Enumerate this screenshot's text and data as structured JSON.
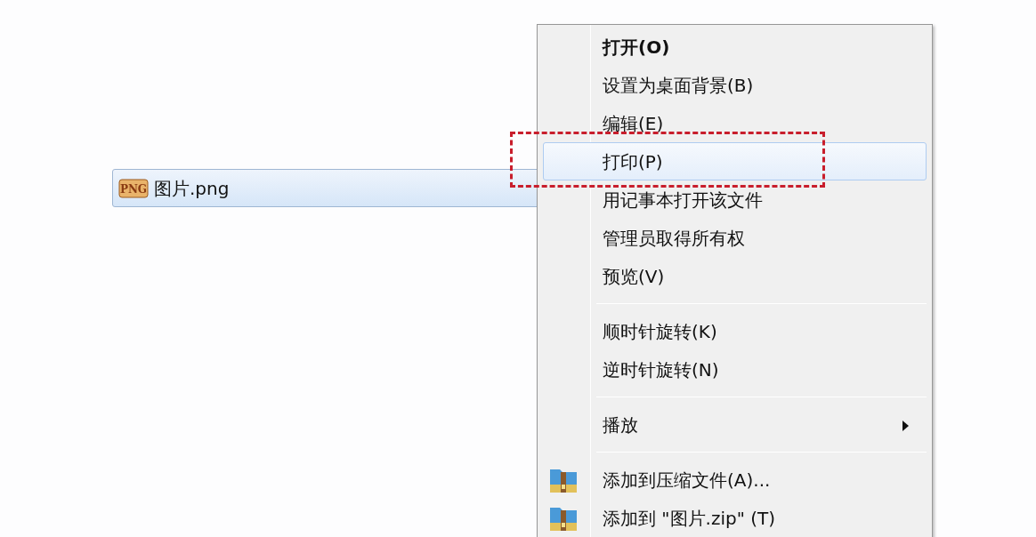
{
  "file_item": {
    "name": "图片.png",
    "icon_text": "PNG",
    "selected": true
  },
  "context_menu": {
    "items": [
      {
        "kind": "item",
        "label": "打开(O)",
        "default": true,
        "selected": false,
        "submenu": false,
        "outlined": false
      },
      {
        "kind": "item",
        "label": "设置为桌面背景(B)",
        "default": false,
        "selected": false,
        "submenu": false,
        "outlined": false
      },
      {
        "kind": "item",
        "label": "编辑(E)",
        "default": false,
        "selected": false,
        "submenu": false,
        "outlined": false
      },
      {
        "kind": "item",
        "label": "打印(P)",
        "default": false,
        "selected": true,
        "submenu": false,
        "outlined": true
      },
      {
        "kind": "item",
        "label": "用记事本打开该文件",
        "default": false,
        "selected": false,
        "submenu": false,
        "outlined": false
      },
      {
        "kind": "item",
        "label": "管理员取得所有权",
        "default": false,
        "selected": false,
        "submenu": false,
        "outlined": false
      },
      {
        "kind": "item",
        "label": "预览(V)",
        "default": false,
        "selected": false,
        "submenu": false,
        "outlined": false
      },
      {
        "kind": "separator"
      },
      {
        "kind": "item",
        "label": "顺时针旋转(K)",
        "default": false,
        "selected": false,
        "submenu": false,
        "outlined": false
      },
      {
        "kind": "item",
        "label": "逆时针旋转(N)",
        "default": false,
        "selected": false,
        "submenu": false,
        "outlined": false
      },
      {
        "kind": "separator"
      },
      {
        "kind": "item",
        "label": "播放",
        "default": false,
        "selected": false,
        "submenu": true,
        "outlined": false
      },
      {
        "kind": "separator"
      },
      {
        "kind": "archive_item",
        "label": "添加到压缩文件(A)...",
        "default": false,
        "selected": false,
        "submenu": false,
        "outlined": false
      },
      {
        "kind": "archive_item",
        "label": "添加到 \"图片.zip\" (T)",
        "default": false,
        "selected": false,
        "submenu": false,
        "outlined": false
      }
    ]
  }
}
